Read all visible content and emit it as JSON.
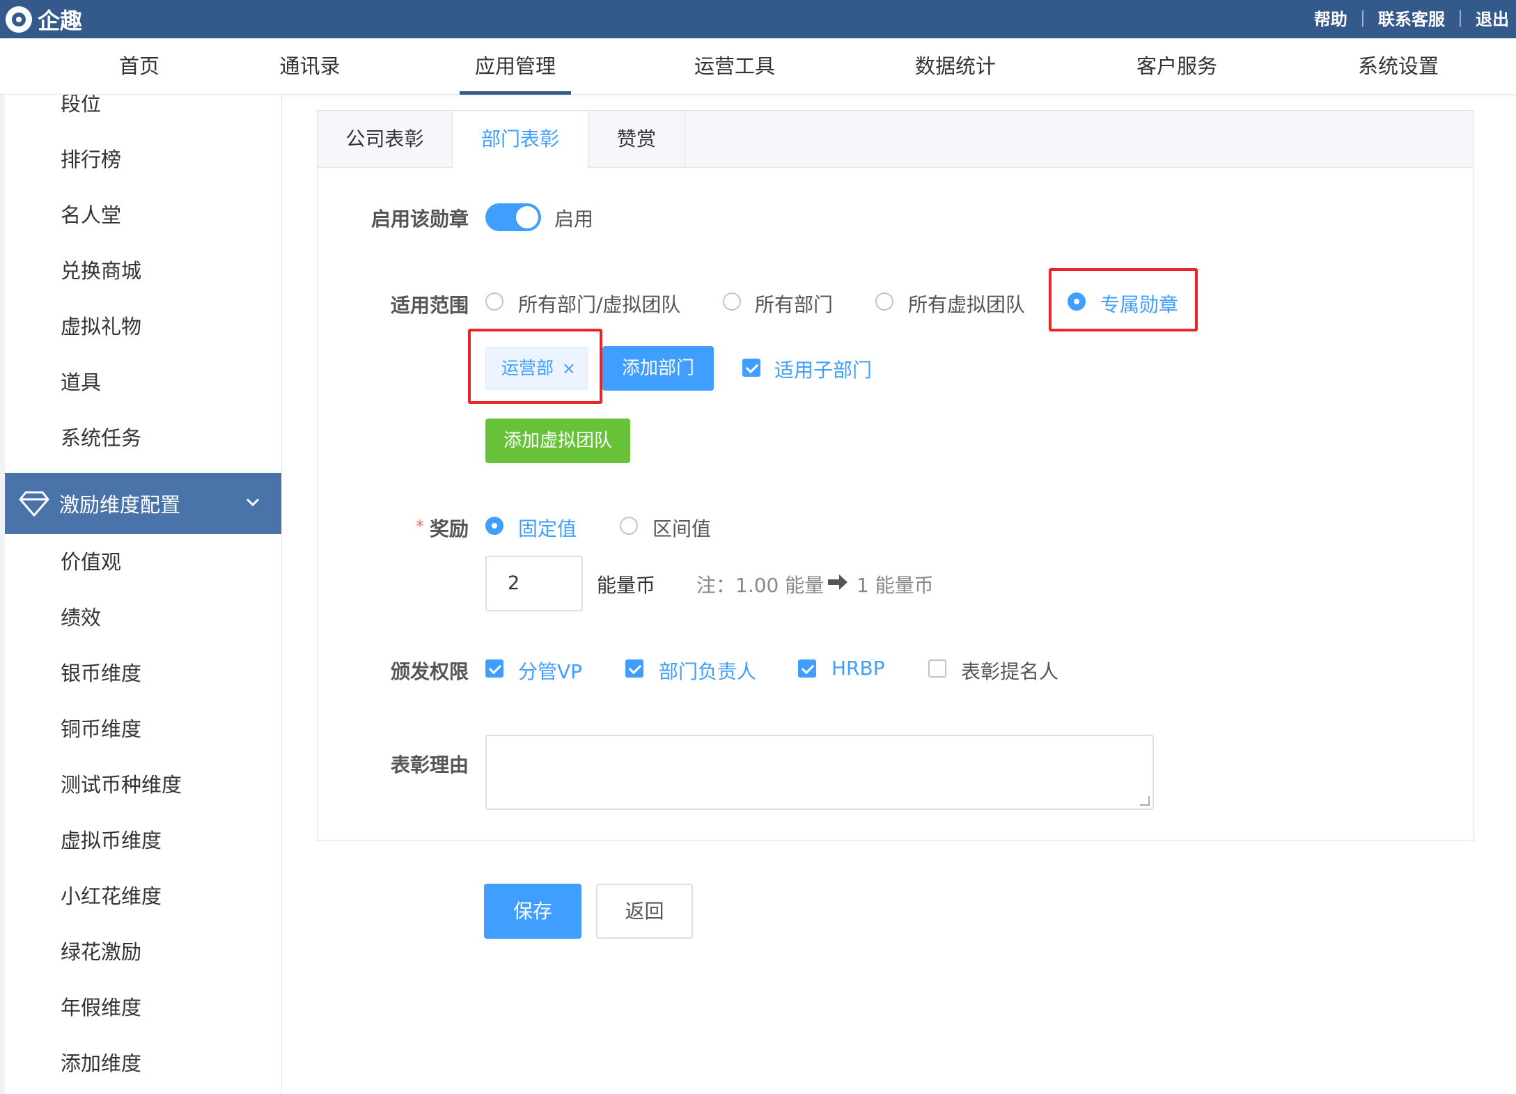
{
  "header": {
    "brand": "企趣",
    "links": [
      "帮助",
      "联系客服",
      "退出"
    ],
    "separator": "|"
  },
  "nav": {
    "items": [
      "首页",
      "通讯录",
      "应用管理",
      "运营工具",
      "数据统计",
      "客户服务",
      "系统设置"
    ],
    "active": "应用管理"
  },
  "sidebar": {
    "items_top": [
      "段位",
      "排行榜",
      "名人堂",
      "兑换商城",
      "虚拟礼物",
      "道具",
      "系统任务"
    ],
    "group": {
      "label": "激励维度配置",
      "icon": "diamond-icon"
    },
    "items_bottom": [
      "价值观",
      "绩效",
      "银币维度",
      "铜币维度",
      "测试币种维度",
      "虚拟币维度",
      "小红花维度",
      "绿花激励",
      "年假维度",
      "添加维度"
    ]
  },
  "tabs": [
    "公司表彰",
    "部门表彰",
    "赞赏"
  ],
  "form": {
    "enable": {
      "label": "启用该勋章",
      "value": "启用",
      "on": true
    },
    "scope": {
      "label": "适用范围",
      "options": [
        "所有部门/虚拟团队",
        "所有部门",
        "所有虚拟团队",
        "专属勋章"
      ],
      "selected": "专属勋章",
      "tag": "运营部",
      "tag_close": "×",
      "add_dept_button": "添加部门",
      "sub_dept_label": "适用子部门",
      "sub_dept_checked": true,
      "add_team_button": "添加虚拟团队"
    },
    "reward": {
      "required": "*",
      "label": "奖励",
      "options": [
        "固定值",
        "区间值"
      ],
      "selected": "固定值",
      "value": "2",
      "unit": "能量币",
      "note_prefix": "注：1.00 能量",
      "note_suffix": "1 能量币"
    },
    "permission": {
      "label": "颁发权限",
      "options": [
        {
          "label": "分管VP",
          "checked": true
        },
        {
          "label": "部门负责人",
          "checked": true
        },
        {
          "label": "HRBP",
          "checked": true
        },
        {
          "label": "表彰提名人",
          "checked": false
        }
      ]
    },
    "reason": {
      "label": "表彰理由",
      "value": ""
    }
  },
  "actions": {
    "save": "保存",
    "back": "返回"
  },
  "colors": {
    "primary": "#409eff",
    "header": "#34598b",
    "sidebar_active": "#4a74a9",
    "success": "#67c23a",
    "highlight": "#e8262a"
  }
}
